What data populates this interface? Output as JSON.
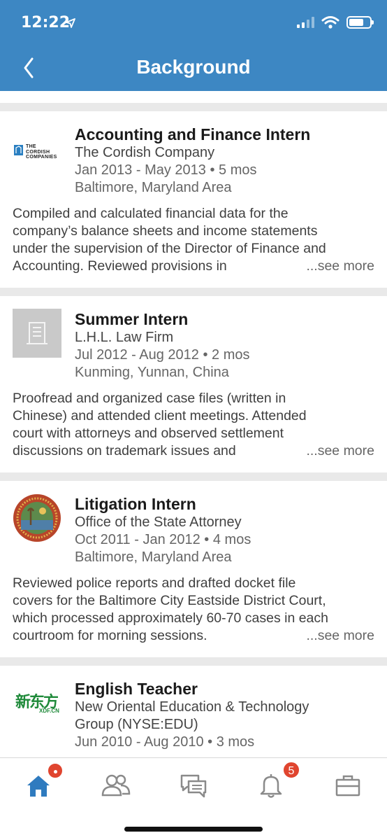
{
  "status": {
    "time": "12:22"
  },
  "header": {
    "title": "Background"
  },
  "experiences": [
    {
      "role": "Accounting and Finance Intern",
      "company": "The Cordish Company",
      "dates": "Jan 2013 - May 2013 • 5 mos",
      "location": "Baltimore, Maryland Area",
      "logo_text_1": "THE",
      "logo_text_2": "CORDISH",
      "logo_text_3": "COMPANIES",
      "description_lines": [
        "Compiled and calculated financial data for the",
        "company’s balance sheets and income statements",
        "under the supervision of the Director of Finance and",
        "Accounting. Reviewed provisions in"
      ],
      "see_more": "...see more"
    },
    {
      "role": "Summer Intern",
      "company": "L.H.L. Law Firm",
      "dates": "Jul 2012 - Aug 2012 • 2 mos",
      "location": "Kunming, Yunnan, China",
      "description_lines": [
        "Proofread and organized case files (written in",
        "Chinese) and attended client meetings. Attended",
        "court with attorneys and observed settlement",
        "discussions on trademark issues and"
      ],
      "see_more": "...see more"
    },
    {
      "role": "Litigation Intern",
      "company": "Office of the State Attorney",
      "dates": "Oct 2011 - Jan 2012 • 4 mos",
      "location": "Baltimore, Maryland Area",
      "description_lines": [
        "Reviewed police reports and drafted docket file",
        "covers for the Baltimore City Eastside District Court,",
        "which processed approximately 60-70 cases in each",
        "courtroom for morning sessions."
      ],
      "see_more": "...see more"
    },
    {
      "role": "English Teacher",
      "company_line_1": "New Oriental Education & Technology",
      "company_line_2": "Group (NYSE:EDU)",
      "dates": "Jun 2010 - Aug 2010 • 3 mos",
      "logo_text_main": "新东方",
      "logo_text_sub": "XDF.CN"
    }
  ],
  "tabbar": {
    "notifications_badge": "5"
  },
  "colors": {
    "brand_blue": "#3d87c3",
    "badge_red": "#e0452f"
  }
}
